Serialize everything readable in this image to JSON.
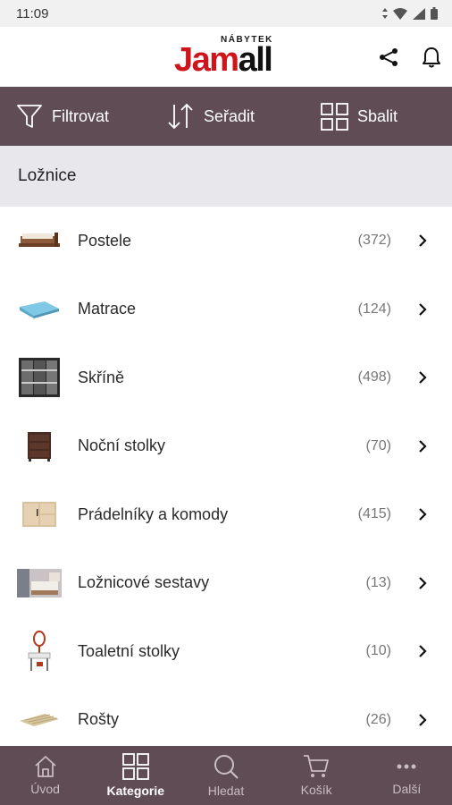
{
  "status_bar": {
    "time": "11:09"
  },
  "header": {
    "logo_small": "NÁBYTEK",
    "logo_red": "Jam",
    "logo_black": "all"
  },
  "toolbar": {
    "filter": "Filtrovat",
    "sort": "Seřadit",
    "collapse": "Sbalit"
  },
  "section": {
    "title": "Ložnice"
  },
  "categories": [
    {
      "label": "Postele",
      "count": "(372)",
      "thumb": "bed-thumbnail"
    },
    {
      "label": "Matrace",
      "count": "(124)",
      "thumb": "mattress-thumbnail"
    },
    {
      "label": "Skříně",
      "count": "(498)",
      "thumb": "wardrobe-thumbnail"
    },
    {
      "label": "Noční stolky",
      "count": "(70)",
      "thumb": "nightstand-thumbnail"
    },
    {
      "label": "Prádelníky a komody",
      "count": "(415)",
      "thumb": "dresser-thumbnail"
    },
    {
      "label": "Ložnicové sestavy",
      "count": "(13)",
      "thumb": "bedroom-set-thumbnail"
    },
    {
      "label": "Toaletní stolky",
      "count": "(10)",
      "thumb": "vanity-table-thumbnail"
    },
    {
      "label": "Rošty",
      "count": "(26)",
      "thumb": "slatted-base-thumbnail"
    }
  ],
  "bottom_nav": [
    {
      "label": "Úvod",
      "icon": "home-icon",
      "active": false
    },
    {
      "label": "Kategorie",
      "icon": "grid-icon",
      "active": true
    },
    {
      "label": "Hledat",
      "icon": "search-icon",
      "active": false
    },
    {
      "label": "Košík",
      "icon": "cart-icon",
      "active": false
    },
    {
      "label": "Další",
      "icon": "more-icon",
      "active": false
    }
  ],
  "colors": {
    "toolbar_bg": "#5f4c55",
    "section_bg": "#e8e8ec",
    "brand_red": "#d0141c"
  }
}
